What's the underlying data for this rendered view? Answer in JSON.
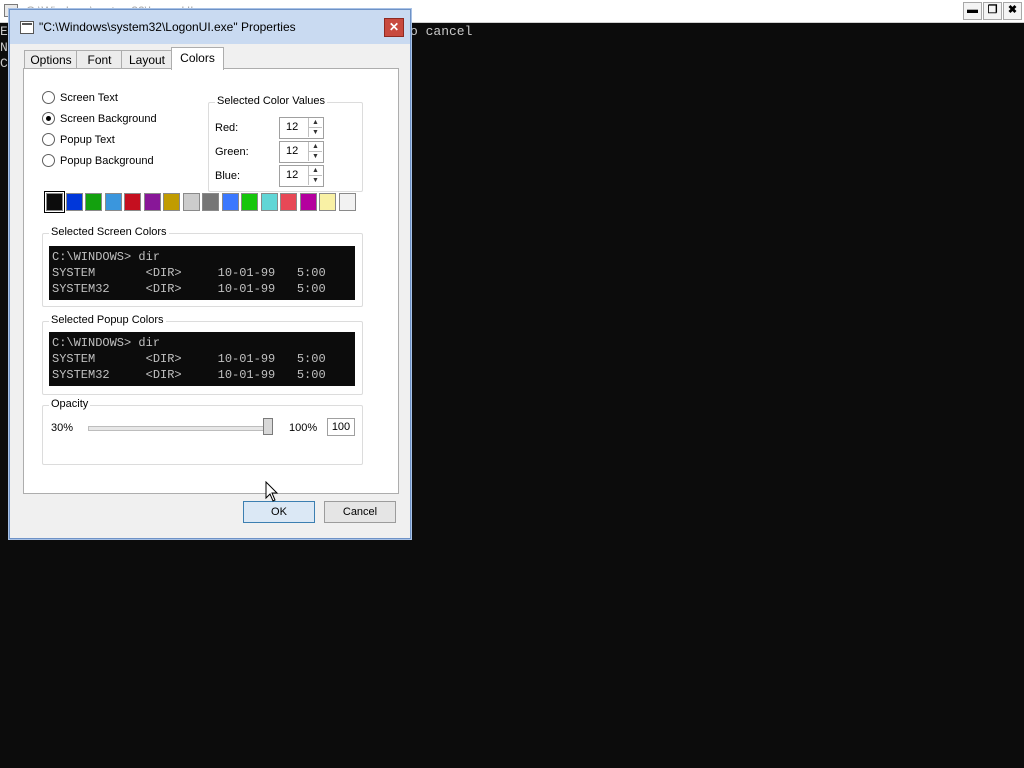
{
  "console": {
    "title": "C:\\Windows\\system32\\LogonUI.exe",
    "text_left": "E\nN\nC",
    "text_right": "o cancel",
    "controls": {
      "minimize": "▬",
      "restore": "❐",
      "close": "✖"
    }
  },
  "dialog": {
    "title": "\"C:\\Windows\\system32\\LogonUI.exe\" Properties",
    "close_symbol": "✕",
    "tabs": [
      {
        "label": "Options",
        "active": false
      },
      {
        "label": "Font",
        "active": false
      },
      {
        "label": "Layout",
        "active": false
      },
      {
        "label": "Colors",
        "active": true
      }
    ],
    "radio_options": [
      {
        "label": "Screen Text",
        "checked": false
      },
      {
        "label": "Screen Background",
        "checked": true
      },
      {
        "label": "Popup Text",
        "checked": false
      },
      {
        "label": "Popup Background",
        "checked": false
      }
    ],
    "color_values": {
      "group_label": "Selected Color Values",
      "red_label": "Red:",
      "red": "12",
      "green_label": "Green:",
      "green": "12",
      "blue_label": "Blue:",
      "blue": "12"
    },
    "palette": [
      "#0c0c0c",
      "#0037da",
      "#13a10e",
      "#3a96dd",
      "#c50f1f",
      "#881798",
      "#c19c00",
      "#cccccc",
      "#767676",
      "#3b78ff",
      "#16c60c",
      "#61d6d6",
      "#e74856",
      "#b4009e",
      "#f9f1a5",
      "#f2f2f2"
    ],
    "selected_swatch": 0,
    "screen_colors": {
      "label": "Selected Screen Colors",
      "lines": [
        "C:\\WINDOWS> dir",
        "SYSTEM       <DIR>     10-01-99   5:00",
        "SYSTEM32     <DIR>     10-01-99   5:00"
      ]
    },
    "popup_colors": {
      "label": "Selected Popup Colors",
      "lines": [
        "C:\\WINDOWS> dir",
        "SYSTEM       <DIR>     10-01-99   5:00",
        "SYSTEM32     <DIR>     10-01-99   5:00"
      ]
    },
    "opacity": {
      "label": "Opacity",
      "min_label": "30%",
      "max_label": "100%",
      "value": "100"
    },
    "ok_label": "OK",
    "cancel_label": "Cancel"
  }
}
